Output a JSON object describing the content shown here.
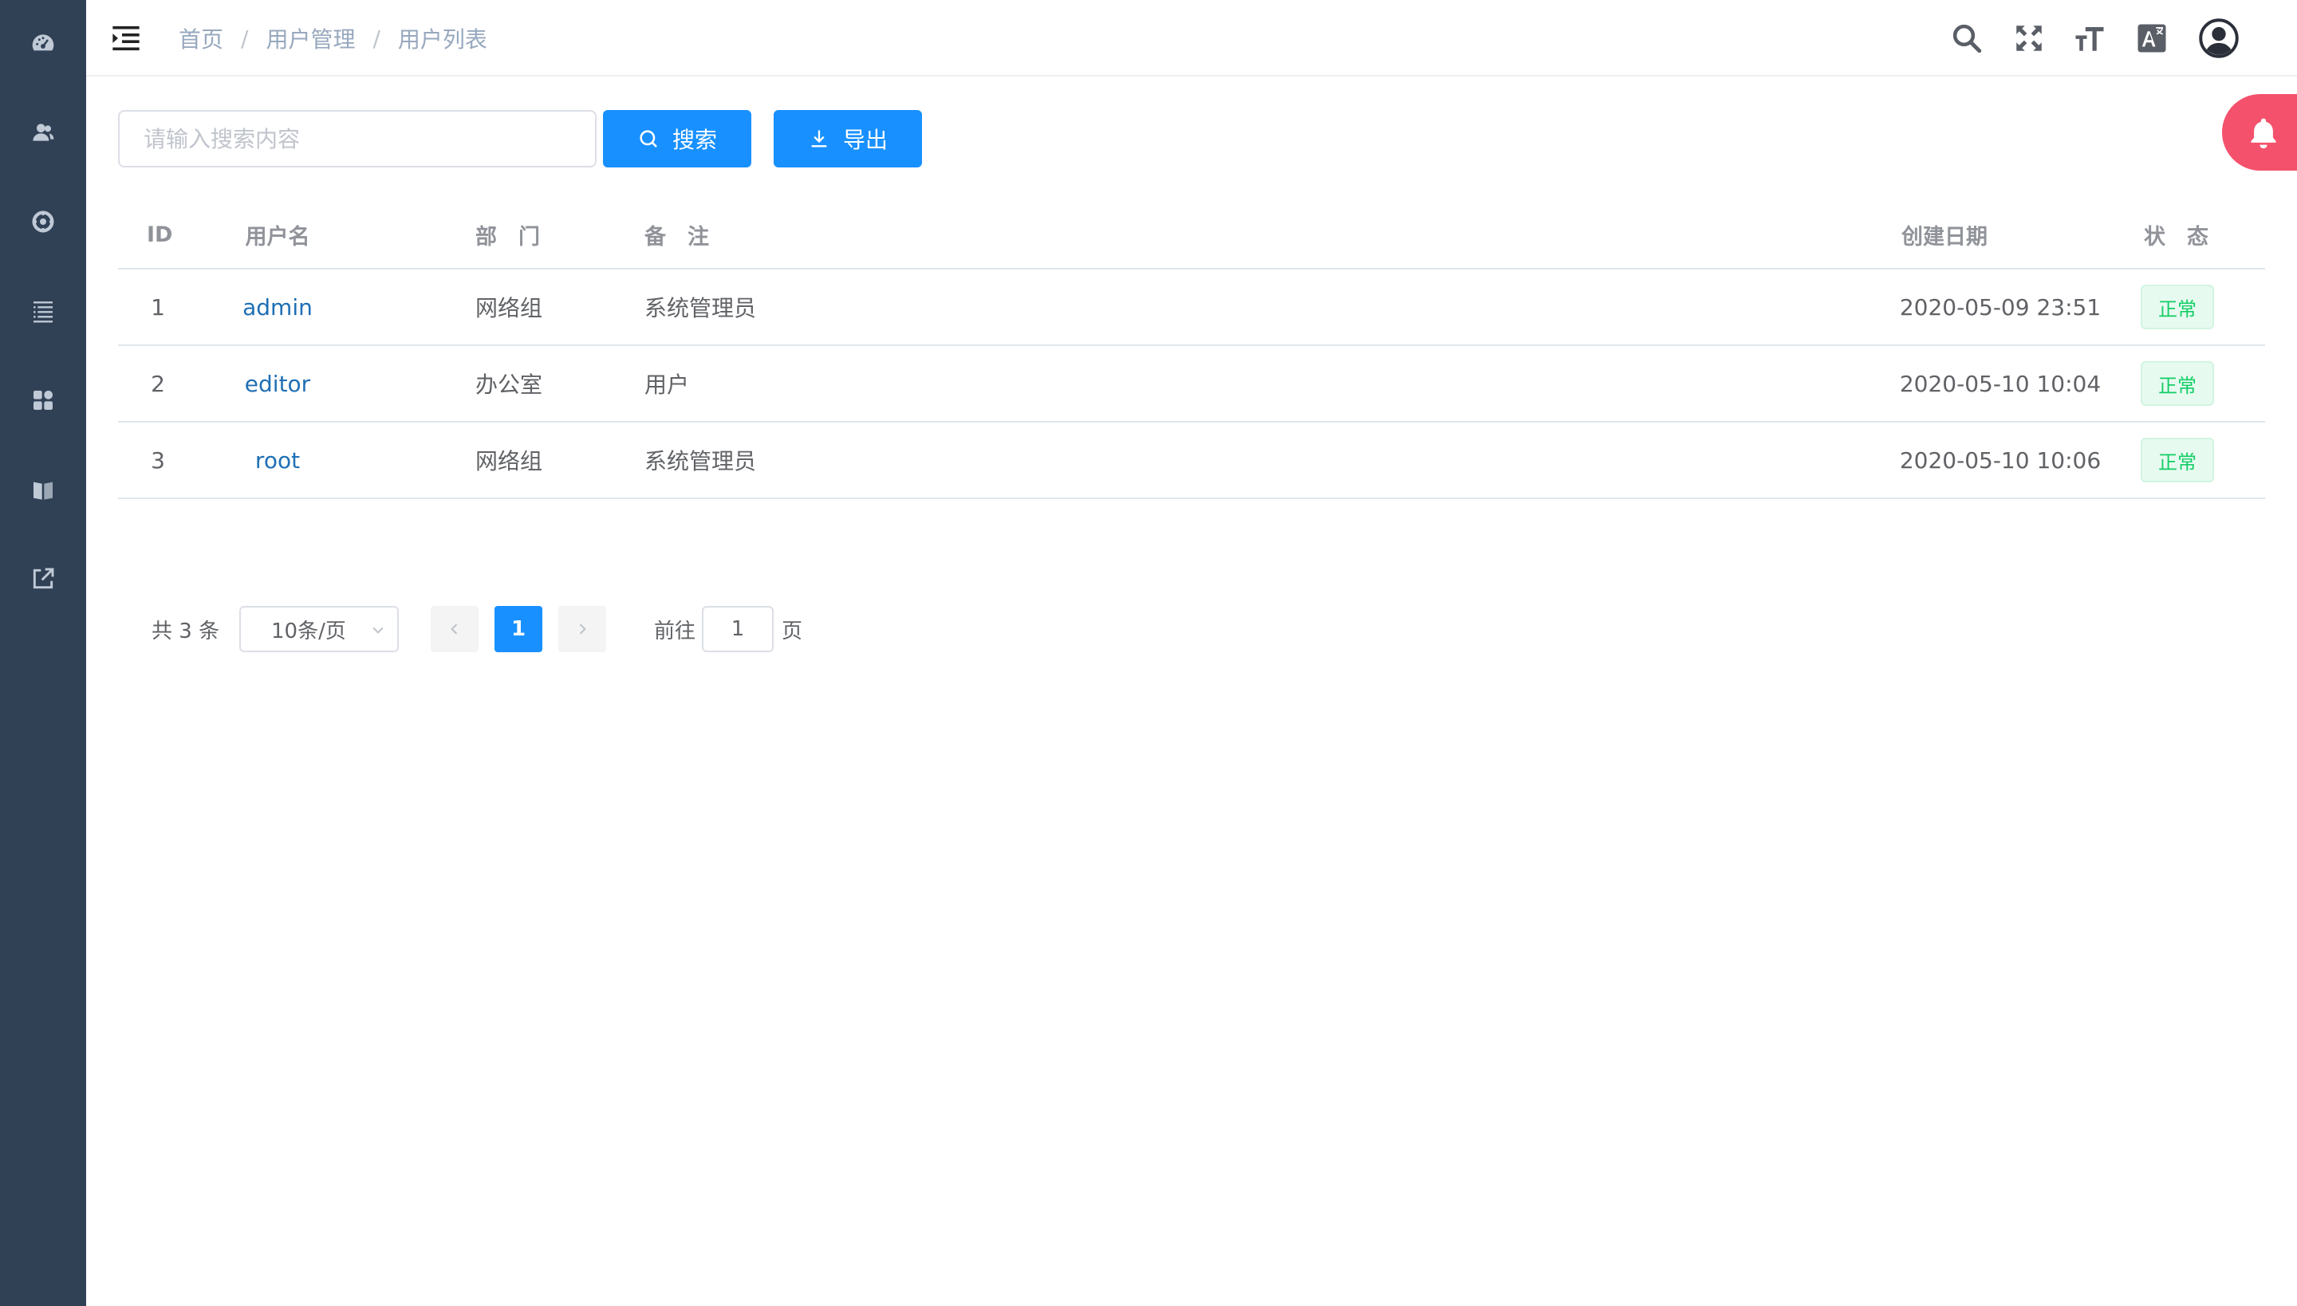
{
  "sidebar": {
    "items": [
      {
        "icon": "dashboard-icon"
      },
      {
        "icon": "users-icon"
      },
      {
        "icon": "settings-gear-icon"
      },
      {
        "icon": "list-icon"
      },
      {
        "icon": "grid-icon"
      },
      {
        "icon": "book-icon"
      },
      {
        "icon": "external-link-icon"
      }
    ]
  },
  "header": {
    "breadcrumb": [
      "首页",
      "用户管理",
      "用户列表"
    ],
    "separator": "/",
    "icons": [
      "search-icon",
      "fullscreen-icon",
      "font-size-icon",
      "translate-icon",
      "user-avatar-icon"
    ]
  },
  "toolbar": {
    "search_placeholder": "请输入搜索内容",
    "search_value": "",
    "search_button": "搜索",
    "export_button": "导出"
  },
  "table": {
    "headers": {
      "id": "ID",
      "username": "用户名",
      "dept": "部　门",
      "note": "备　注",
      "created": "创建日期",
      "status": "状　态"
    },
    "rows": [
      {
        "id": "1",
        "username": "admin",
        "dept": "网络组",
        "note": "系统管理员",
        "created": "2020-05-09 23:51",
        "status": "正常"
      },
      {
        "id": "2",
        "username": "editor",
        "dept": "办公室",
        "note": "用户",
        "created": "2020-05-10 10:04",
        "status": "正常"
      },
      {
        "id": "3",
        "username": "root",
        "dept": "网络组",
        "note": "系统管理员",
        "created": "2020-05-10 10:06",
        "status": "正常"
      }
    ]
  },
  "pagination": {
    "total_text": "共 3 条",
    "page_size": "10条/页",
    "current_page": "1",
    "goto_label": "前往",
    "goto_value": "1",
    "goto_unit": "页"
  },
  "colors": {
    "sidebar_bg": "#304156",
    "primary": "#1890ff",
    "notification": "#f4516c",
    "status_success": "#13ce66"
  }
}
